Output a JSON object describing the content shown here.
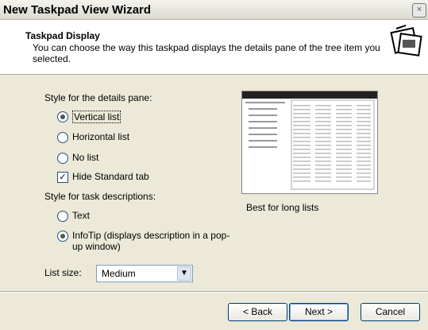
{
  "window": {
    "title": "New Taskpad View Wizard",
    "close": "×"
  },
  "header": {
    "title": "Taskpad Display",
    "description": "You can choose the way this taskpad displays the details pane of the tree item you selected."
  },
  "details_pane": {
    "label": "Style for the details pane:",
    "options": [
      {
        "label": "Vertical list",
        "selected": true
      },
      {
        "label": "Horizontal list",
        "selected": false
      },
      {
        "label": "No list",
        "selected": false
      }
    ],
    "hide_standard_tab": {
      "label": "Hide Standard tab",
      "checked": true
    }
  },
  "task_descriptions": {
    "label": "Style for task descriptions:",
    "options": [
      {
        "label": "Text",
        "selected": false
      },
      {
        "label": "InfoTip (displays description in a pop-up window)",
        "selected": true
      }
    ]
  },
  "list_size": {
    "label": "List size:",
    "value": "Medium"
  },
  "preview": {
    "caption": "Best for long lists"
  },
  "buttons": {
    "back": "< Back",
    "next": "Next >",
    "cancel": "Cancel"
  }
}
